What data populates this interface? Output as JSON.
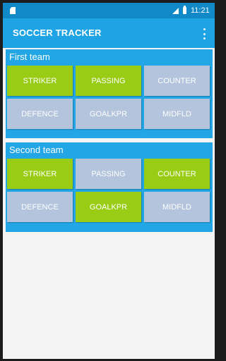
{
  "status_bar": {
    "time": "11:21"
  },
  "app_bar": {
    "title": "SOCCER TRACKER"
  },
  "colors": {
    "status_bar": "#1189c8",
    "app_bar": "#1ea4e4",
    "panel": "#22a6e6",
    "active_button": "#99cc14",
    "inactive_button": "#b3c4dc"
  },
  "teams": [
    {
      "label": "First team",
      "buttons": [
        {
          "label": "STRIKER",
          "active": true
        },
        {
          "label": "PASSING",
          "active": true
        },
        {
          "label": "COUNTER",
          "active": false
        },
        {
          "label": "DEFENCE",
          "active": false
        },
        {
          "label": "GOALKPR",
          "active": false
        },
        {
          "label": "MIDFLD",
          "active": false
        }
      ]
    },
    {
      "label": "Second team",
      "buttons": [
        {
          "label": "STRIKER",
          "active": true
        },
        {
          "label": "PASSING",
          "active": false
        },
        {
          "label": "COUNTER",
          "active": true
        },
        {
          "label": "DEFENCE",
          "active": false
        },
        {
          "label": "GOALKPR",
          "active": true
        },
        {
          "label": "MIDFLD",
          "active": false
        }
      ]
    }
  ],
  "icons": [
    "sd-card-icon",
    "signal-icon",
    "battery-icon",
    "overflow-menu-icon"
  ]
}
